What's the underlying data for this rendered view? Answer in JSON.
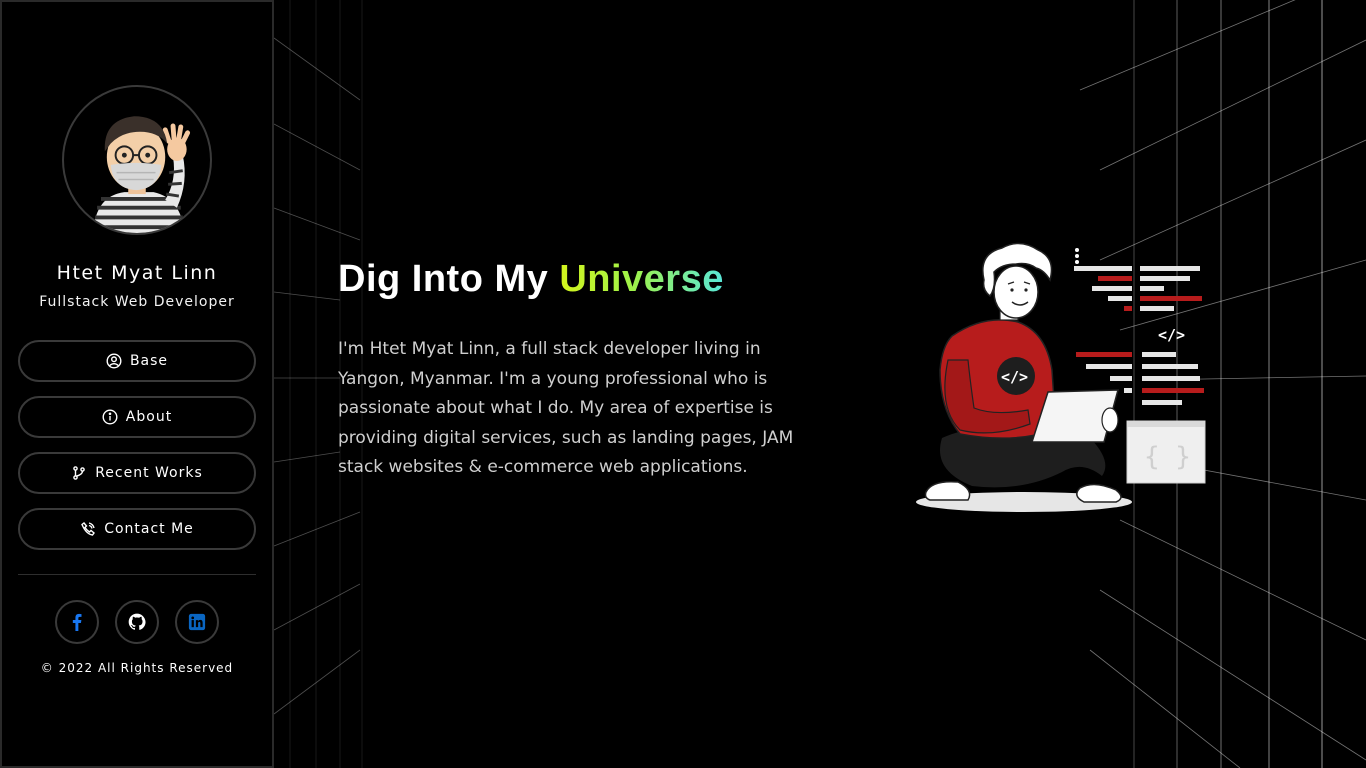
{
  "profile": {
    "name": "Htet Myat Linn",
    "role": "Fullstack Web Developer"
  },
  "nav": {
    "items": [
      {
        "label": "Base",
        "icon": "user-circle-icon"
      },
      {
        "label": "About",
        "icon": "info-icon"
      },
      {
        "label": "Recent Works",
        "icon": "git-branch-icon"
      },
      {
        "label": "Contact Me",
        "icon": "signal-icon"
      }
    ]
  },
  "socials": [
    {
      "name": "facebook",
      "icon": "facebook-icon",
      "color": "#1877f2"
    },
    {
      "name": "github",
      "icon": "github-icon",
      "color": "#ffffff"
    },
    {
      "name": "linkedin",
      "icon": "linkedin-icon",
      "color": "#0a66c2"
    }
  ],
  "footer": {
    "copyright": "© 2022 All Rights Reserved"
  },
  "hero": {
    "title_main": "Dig Into My ",
    "title_accent": "Universe",
    "description": "I'm Htet Myat Linn, a full stack developer living in Yangon, Myanmar. I'm a young professional who is passionate about what I do. My area of expertise is providing digital services, such as landing pages, JAM stack websites & e-commerce web applications."
  },
  "illustration": {
    "code_tag": "</>",
    "braces": "{ }"
  },
  "colors": {
    "background": "#000000",
    "border": "#3a3a3a",
    "accent_start": "#d4f51c",
    "accent_end": "#58e6d9",
    "illustration_red": "#b71c1c"
  }
}
